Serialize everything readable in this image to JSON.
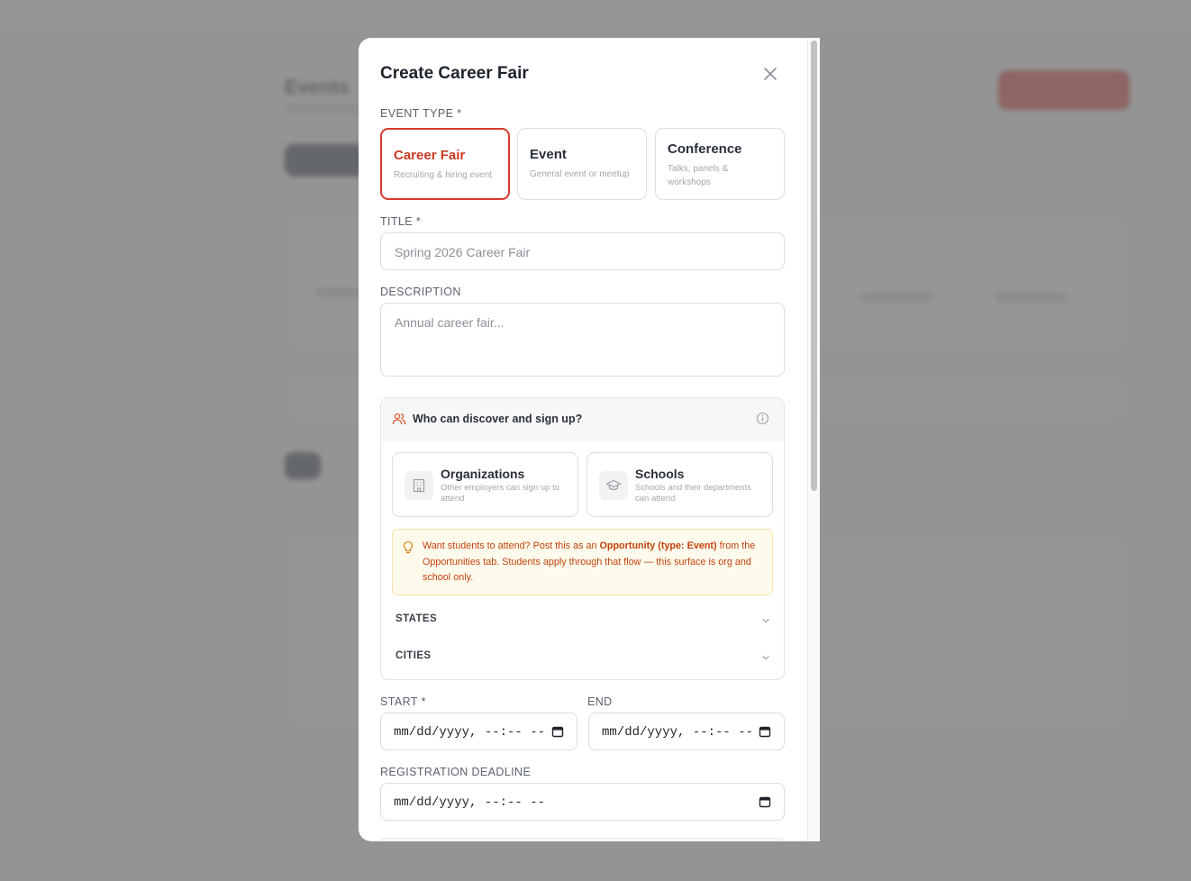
{
  "modal": {
    "title": "Create Career Fair",
    "close_label": "×"
  },
  "event_type": {
    "label": "EVENT TYPE *",
    "options": [
      {
        "title": "Career Fair",
        "subtitle": "Recruiting & hiring event",
        "selected": true
      },
      {
        "title": "Event",
        "subtitle": "General event or meetup",
        "selected": false
      },
      {
        "title": "Conference",
        "subtitle": "Talks, panels & workshops",
        "selected": false
      }
    ]
  },
  "title_field": {
    "label": "TITLE *",
    "placeholder": "Spring 2026 Career Fair",
    "value": ""
  },
  "description_field": {
    "label": "DESCRIPTION",
    "placeholder": "Annual career fair...",
    "value": ""
  },
  "audience": {
    "heading": "Who can discover and sign up?",
    "options": [
      {
        "title": "Organizations",
        "subtitle": "Other employers can sign up to attend",
        "icon": "building-icon"
      },
      {
        "title": "Schools",
        "subtitle": "Schools and their departments can attend",
        "icon": "graduation-cap-icon"
      }
    ],
    "tip": {
      "prefix": "Want students to attend? Post this as an ",
      "bold": "Opportunity (type: Event)",
      "suffix": " from the Opportunities tab. Students apply through that flow — this surface is org and school only."
    },
    "filters": [
      {
        "label": "STATES"
      },
      {
        "label": "CITIES"
      }
    ]
  },
  "dates": {
    "start_label": "START *",
    "end_label": "END",
    "deadline_label": "REGISTRATION DEADLINE",
    "placeholder": "mm/dd/yyyy, --:-- --"
  },
  "colors": {
    "accent": "#d8392b",
    "tip_bg": "#fffbec",
    "tip_text": "#c2410c"
  }
}
